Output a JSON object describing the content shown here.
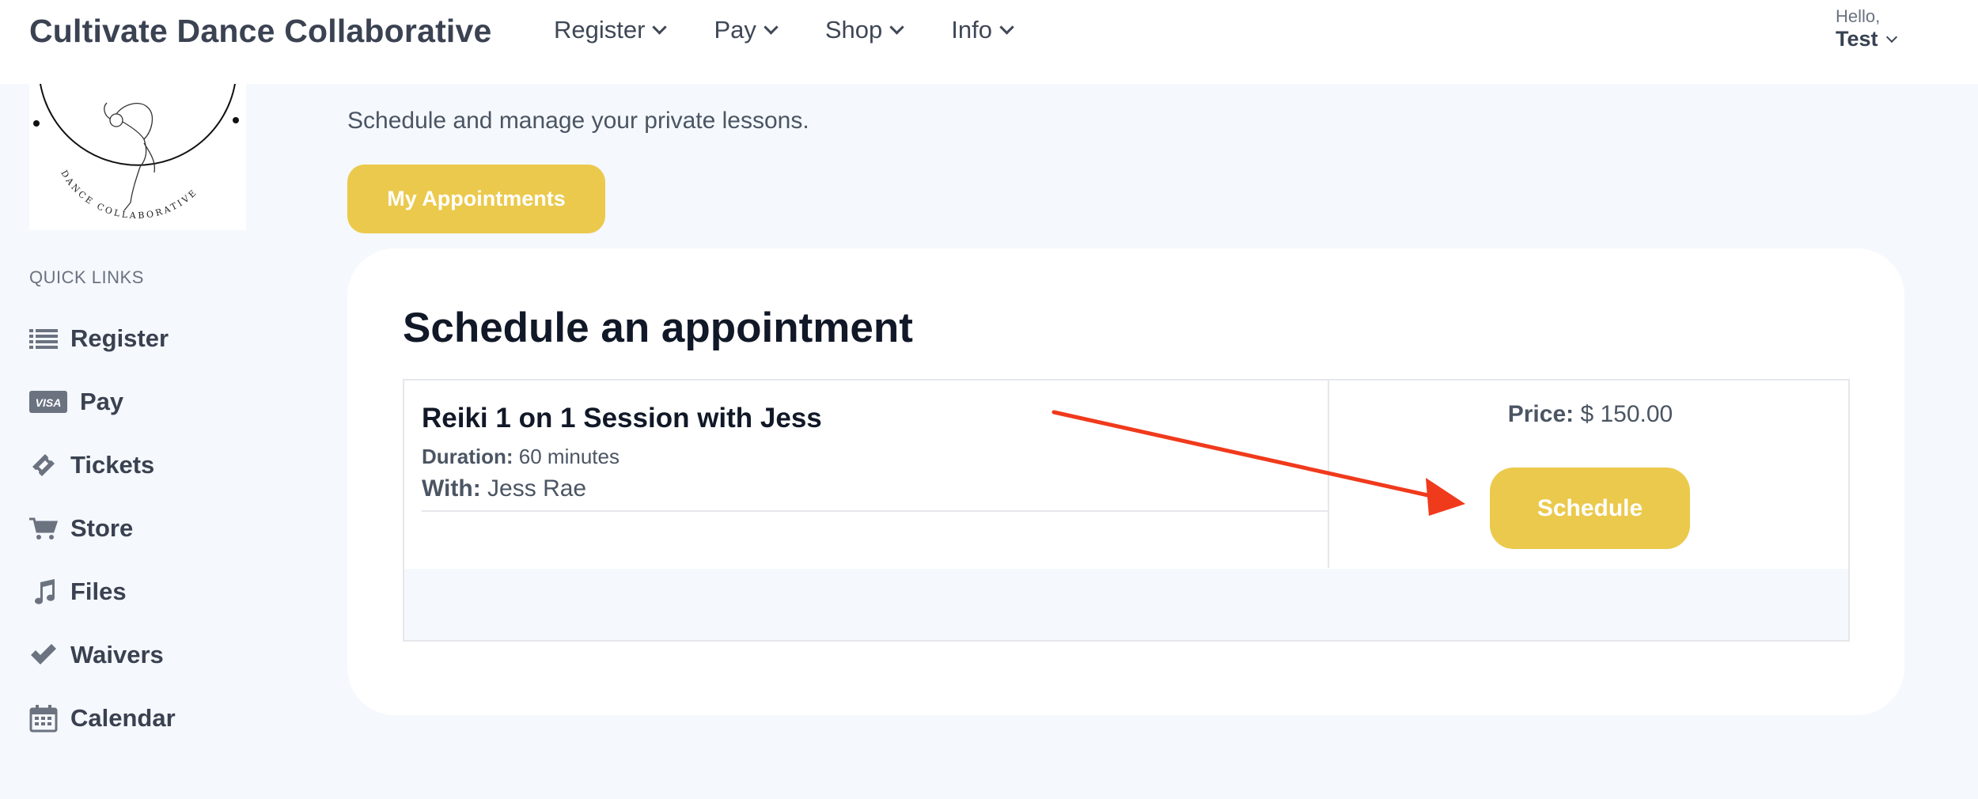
{
  "header": {
    "brand": "Cultivate Dance Collaborative",
    "nav": [
      {
        "label": "Register"
      },
      {
        "label": "Pay"
      },
      {
        "label": "Shop"
      },
      {
        "label": "Info"
      }
    ],
    "user": {
      "greeting": "Hello,",
      "name": "Test"
    }
  },
  "sidebar": {
    "logo_text": "DANCE COLLABORATIVE",
    "quick_links_title": "QUICK LINKS",
    "items": [
      {
        "label": "Register",
        "icon": "list-icon"
      },
      {
        "label": "Pay",
        "icon": "visa-card-icon"
      },
      {
        "label": "Tickets",
        "icon": "ticket-icon"
      },
      {
        "label": "Store",
        "icon": "cart-icon"
      },
      {
        "label": "Files",
        "icon": "music-note-icon"
      },
      {
        "label": "Waivers",
        "icon": "check-icon"
      },
      {
        "label": "Calendar",
        "icon": "calendar-icon"
      }
    ]
  },
  "main": {
    "subtitle": "Schedule and manage your private lessons.",
    "my_appointments_label": "My Appointments",
    "card_title": "Schedule an appointment",
    "appointment": {
      "name": "Reiki 1 on 1 Session with Jess",
      "duration_label": "Duration:",
      "duration_value": "60 minutes",
      "with_label": "With:",
      "with_value": "Jess Rae",
      "price_label": "Price:",
      "price_value": "$ 150.00",
      "schedule_label": "Schedule"
    }
  },
  "colors": {
    "accent_yellow": "#ebc94c",
    "annotation_arrow": "#f03a1c",
    "page_bg": "#f5f8fc"
  }
}
